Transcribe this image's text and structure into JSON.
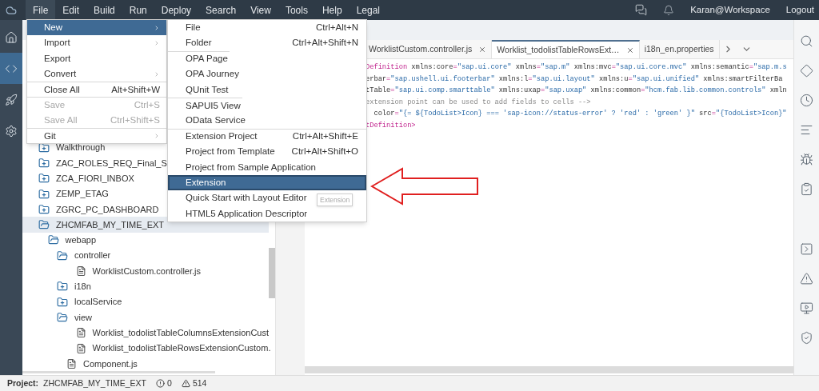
{
  "menu_bar": {
    "items": [
      {
        "label": "File",
        "selected": true
      },
      {
        "label": "Edit",
        "selected": false
      },
      {
        "label": "Build",
        "selected": false
      },
      {
        "label": "Run",
        "selected": false
      },
      {
        "label": "Deploy",
        "selected": false
      },
      {
        "label": "Search",
        "selected": false
      },
      {
        "label": "View",
        "selected": false
      },
      {
        "label": "Tools",
        "selected": false
      },
      {
        "label": "Help",
        "selected": false
      },
      {
        "label": "Legal",
        "selected": false
      }
    ],
    "user": "Karan@Workspace",
    "logout": "Logout"
  },
  "left_sidebar": [
    {
      "kind": "home",
      "selected": false
    },
    {
      "kind": "code",
      "selected": true
    },
    {
      "kind": "deploy",
      "selected": false
    },
    {
      "kind": "settings",
      "selected": false
    }
  ],
  "file_menu": [
    {
      "label": "New",
      "submenu": true,
      "selected": true,
      "disabled": false,
      "separator_before": false
    },
    {
      "label": "Import",
      "submenu": true,
      "selected": false,
      "disabled": false,
      "separator_before": false
    },
    {
      "label": "Export",
      "submenu": false,
      "selected": false,
      "disabled": false,
      "separator_before": false
    },
    {
      "label": "Convert",
      "submenu": true,
      "selected": false,
      "disabled": false,
      "separator_before": false
    },
    {
      "label": "Close All",
      "shortcut": "Alt+Shift+W",
      "submenu": false,
      "selected": false,
      "disabled": false,
      "separator_before": true
    },
    {
      "label": "Save",
      "shortcut": "Ctrl+S",
      "submenu": false,
      "selected": false,
      "disabled": true,
      "separator_before": true
    },
    {
      "label": "Save All",
      "shortcut": "Ctrl+Shift+S",
      "submenu": false,
      "selected": false,
      "disabled": true,
      "separator_before": false
    },
    {
      "label": "Git",
      "submenu": true,
      "selected": false,
      "disabled": false,
      "separator_before": true
    }
  ],
  "new_submenu": [
    {
      "label": "File",
      "shortcut": "Ctrl+Alt+N",
      "selected": false,
      "separator_before": false
    },
    {
      "label": "Folder",
      "shortcut": "Ctrl+Alt+Shift+N",
      "selected": false,
      "separator_before": false
    },
    {
      "label": "OPA Page",
      "selected": false,
      "separator_before": true
    },
    {
      "label": "OPA Journey",
      "selected": false,
      "separator_before": false
    },
    {
      "label": "QUnit Test",
      "selected": false,
      "separator_before": false
    },
    {
      "label": "SAPUI5 View",
      "selected": false,
      "separator_before": true
    },
    {
      "label": "OData Service",
      "selected": false,
      "separator_before": false
    },
    {
      "label": "Extension Project",
      "shortcut": "Ctrl+Alt+Shift+E",
      "selected": false,
      "separator_before": true
    },
    {
      "label": "Project from Template",
      "shortcut": "Ctrl+Alt+Shift+O",
      "selected": false,
      "separator_before": false
    },
    {
      "label": "Project from Sample Application",
      "selected": false,
      "separator_before": false
    },
    {
      "label": "Extension",
      "selected": true,
      "separator_before": false
    },
    {
      "label": "Quick Start with Layout Editor",
      "selected": false,
      "separator_before": false
    },
    {
      "label": "HTML5 Application Descriptor",
      "selected": false,
      "separator_before": false
    }
  ],
  "tooltip": "Extension",
  "tree": [
    {
      "label": "Walkthrough",
      "kind": "folder",
      "expanded": false,
      "selected": false
    },
    {
      "label": "ZAC_ROLES_REQ_Final_S",
      "kind": "folder",
      "expanded": false,
      "selected": false
    },
    {
      "label": "ZCA_FIORI_INBOX",
      "kind": "folder",
      "expanded": false,
      "selected": false
    },
    {
      "label": "ZEMP_ETAG",
      "kind": "folder",
      "expanded": false,
      "selected": false
    },
    {
      "label": "ZGRC_PC_DASHBOARD",
      "kind": "folder",
      "expanded": false,
      "selected": false
    },
    {
      "label": "ZHCMFAB_MY_TIME_EXT",
      "kind": "folder",
      "expanded": true,
      "selected": true,
      "children": [
        {
          "label": "webapp",
          "kind": "folder",
          "expanded": true,
          "selected": false,
          "children": [
            {
              "label": "controller",
              "kind": "folder",
              "expanded": true,
              "selected": false,
              "children": [
                {
                  "label": "WorklistCustom.controller.js",
                  "kind": "file",
                  "selected": false
                }
              ]
            },
            {
              "label": "i18n",
              "kind": "folder",
              "expanded": false,
              "selected": false
            },
            {
              "label": "localService",
              "kind": "folder",
              "expanded": false,
              "selected": false
            },
            {
              "label": "view",
              "kind": "folder",
              "expanded": true,
              "selected": false,
              "children": [
                {
                  "label": "Worklist_todolistTableColumnsExtensionCust",
                  "kind": "file",
                  "selected": false
                },
                {
                  "label": "Worklist_todolistTableRowsExtensionCustom.",
                  "kind": "file",
                  "selected": false
                }
              ]
            },
            {
              "label": "Component.js",
              "kind": "file",
              "selected": false
            }
          ]
        }
      ]
    }
  ],
  "editor_tabs": [
    {
      "label": "WorklistCustom.controller.js",
      "selected": false
    },
    {
      "label": "Worklist_todolistTableRowsExt…",
      "selected": true
    },
    {
      "label": "i18n_en.properties",
      "selected": false
    }
  ],
  "code_lines": [
    [
      {
        "kind": "tag",
        "text": "Definition"
      },
      {
        "kind": "attr",
        "text": " xmlns:core"
      },
      {
        "kind": "op",
        "text": "="
      },
      {
        "kind": "str",
        "text": "\"sap.ui.core\""
      },
      {
        "kind": "attr",
        "text": " xmlns"
      },
      {
        "kind": "op",
        "text": "="
      },
      {
        "kind": "str",
        "text": "\"sap.m\""
      },
      {
        "kind": "attr",
        "text": " xmlns:mvc"
      },
      {
        "kind": "op",
        "text": "="
      },
      {
        "kind": "str",
        "text": "\"sap.ui.core.mvc\""
      },
      {
        "kind": "attr",
        "text": " xmlns:semantic"
      },
      {
        "kind": "op",
        "text": "="
      },
      {
        "kind": "str",
        "text": "\"sap.m.s"
      }
    ],
    [
      {
        "kind": "attr",
        "text": "erbar"
      },
      {
        "kind": "op",
        "text": "="
      },
      {
        "kind": "str",
        "text": "\"sap.ushell.ui.footerbar\""
      },
      {
        "kind": "attr",
        "text": " xmlns:l"
      },
      {
        "kind": "op",
        "text": "="
      },
      {
        "kind": "str",
        "text": "\"sap.ui.layout\""
      },
      {
        "kind": "attr",
        "text": " xmlns:u"
      },
      {
        "kind": "op",
        "text": "="
      },
      {
        "kind": "str",
        "text": "\"sap.ui.unified\""
      },
      {
        "kind": "attr",
        "text": " xmlns:smartFilterBa"
      }
    ],
    [
      {
        "kind": "attr",
        "text": "tTable"
      },
      {
        "kind": "op",
        "text": "="
      },
      {
        "kind": "str",
        "text": "\"sap.ui.comp.smarttable\""
      },
      {
        "kind": "attr",
        "text": " xmlns:uxap"
      },
      {
        "kind": "op",
        "text": "="
      },
      {
        "kind": "str",
        "text": "\"sap.uxap\""
      },
      {
        "kind": "attr",
        "text": " xmlns:common"
      },
      {
        "kind": "op",
        "text": "="
      },
      {
        "kind": "str",
        "text": "\"hcm.fab.lib.common.controls\""
      },
      {
        "kind": "attr",
        "text": " xmln"
      }
    ],
    [
      {
        "kind": "comment",
        "text": "extension point can be used to add fields to cells -->"
      }
    ],
    [
      {
        "kind": "attr",
        "text": "  color"
      },
      {
        "kind": "op",
        "text": "="
      },
      {
        "kind": "str",
        "text": "\"{= ${TodoList>Icon} === 'sap-icon://status-error' ? 'red' : 'green' }\""
      },
      {
        "kind": "attr",
        "text": " src"
      },
      {
        "kind": "op",
        "text": "="
      },
      {
        "kind": "str",
        "text": "\"{TodoList>Icon}\""
      }
    ],
    [
      {
        "kind": "tag",
        "text": "tDefinition>"
      }
    ]
  ],
  "right_sidebar_top": [
    {
      "kind": "search"
    },
    {
      "kind": "git"
    },
    {
      "kind": "history"
    },
    {
      "kind": "outline"
    },
    {
      "kind": "debug"
    },
    {
      "kind": "review"
    }
  ],
  "right_sidebar_bottom": [
    {
      "kind": "console"
    },
    {
      "kind": "problems"
    },
    {
      "kind": "preview"
    },
    {
      "kind": "security"
    }
  ],
  "status_bar": {
    "label": "Project:",
    "project": "ZHCMFAB_MY_TIME_EXT",
    "errors": "0",
    "warnings": "514"
  }
}
